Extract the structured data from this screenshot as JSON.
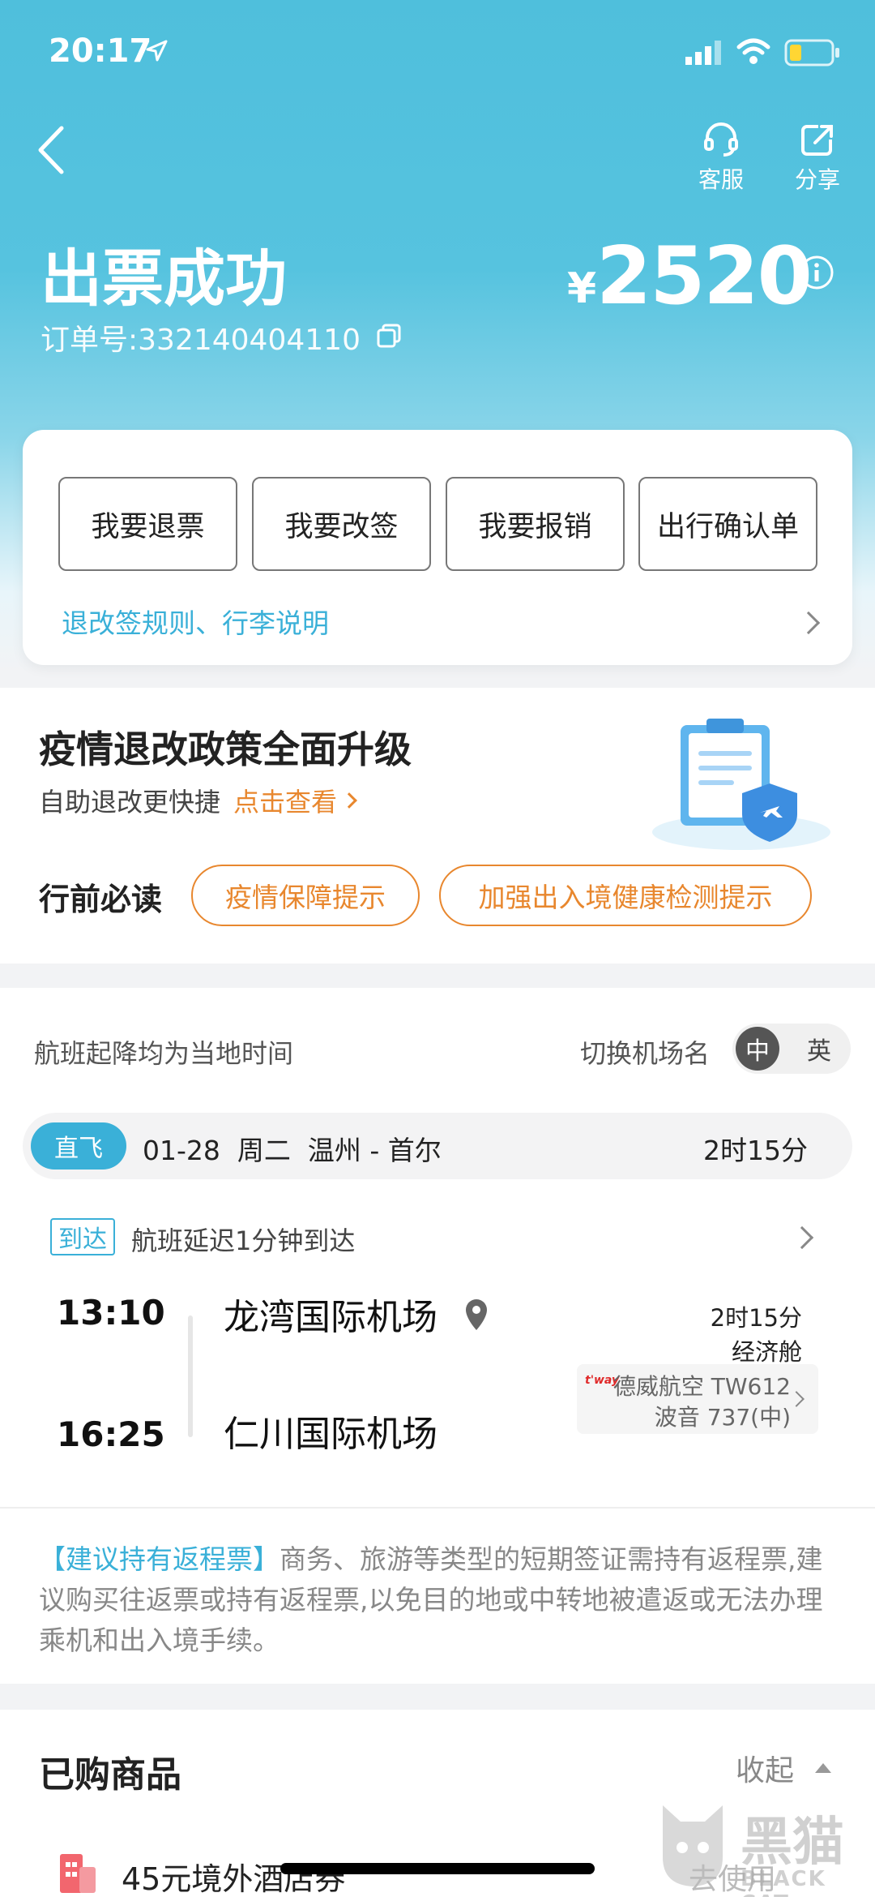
{
  "status_bar": {
    "time": "20:17"
  },
  "header": {
    "back_label": "",
    "service_label": "客服",
    "share_label": "分享",
    "title": "出票成功",
    "order_label": "订单号:332140404110",
    "currency": "¥",
    "price": "2520"
  },
  "actions": {
    "refund": "我要退票",
    "change": "我要改签",
    "reimburse": "我要报销",
    "confirm": "出行确认单",
    "rules_link": "退改签规则、行李说明"
  },
  "epidemic": {
    "title": "疫情退改政策全面升级",
    "subtitle": "自助退改更快捷",
    "link": "点击查看",
    "must_read": "行前必读",
    "tag1": "疫情保障提示",
    "tag2": "加强出入境健康检测提示"
  },
  "flight": {
    "time_note": "航班起降均为当地时间",
    "switch_label": "切换机场名",
    "lang_zh": "中",
    "lang_en": "英",
    "direct_badge": "直飞",
    "date_route": "01-28  周二  温州 - 首尔",
    "duration": "2时15分",
    "arrive_tag": "到达",
    "delay_note": "航班延迟1分钟到达",
    "dep_time": "13:10",
    "dep_airport": "龙湾国际机场",
    "arr_time": "16:25",
    "arr_airport": "仁川国际机场",
    "duration2": "2时15分",
    "cabin": "经济舱",
    "airline_logo": "t'way",
    "airline": "德威航空 TW612",
    "aircraft": "波音 737(中)"
  },
  "notice": {
    "highlight": "【建议持有返程票】",
    "text": "商务、旅游等类型的短期签证需持有返程票,建议购买往返票或持有返程票,以免目的地或中转地被遣返或无法办理乘机和出入境手续。"
  },
  "purchased": {
    "title": "已购商品",
    "collapse": "收起",
    "item1": "45元境外酒店券",
    "item1_action": "去使用"
  },
  "watermark": {
    "line1": "黑猫",
    "line2": "BLACK CAT"
  }
}
